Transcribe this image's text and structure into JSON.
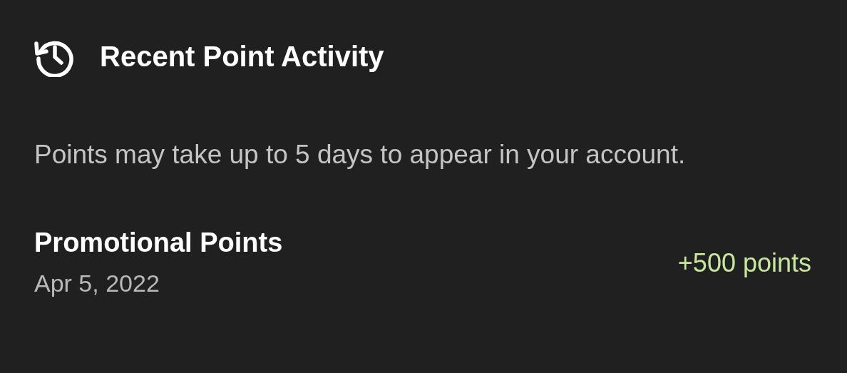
{
  "header": {
    "title": "Recent Point Activity"
  },
  "notice": "Points may take up to 5 days to appear in your account.",
  "activities": [
    {
      "title": "Promotional Points",
      "date": "Apr 5, 2022",
      "points": "+500 points"
    }
  ]
}
